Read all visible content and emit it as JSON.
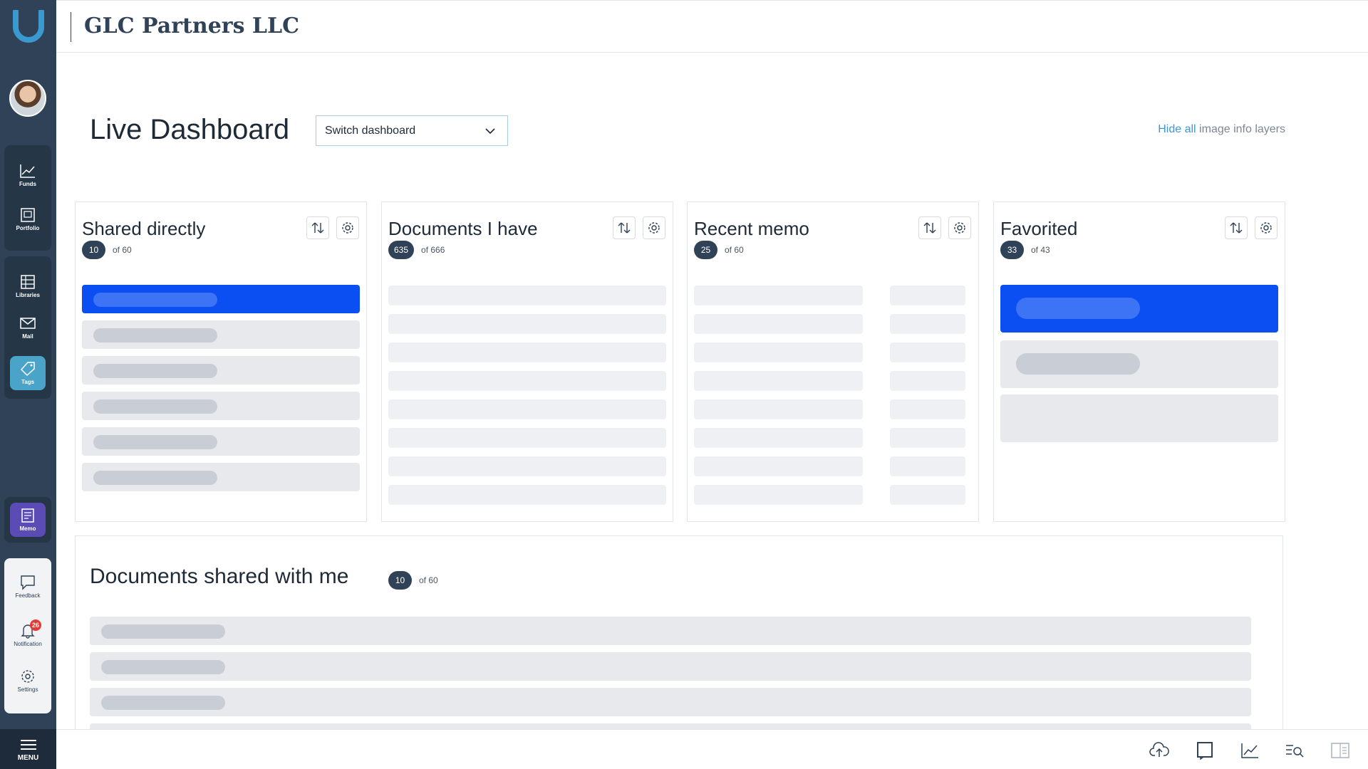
{
  "sidebar": {
    "nav": [
      {
        "id": "funds",
        "label": "Funds",
        "icon": "chart-line-icon"
      },
      {
        "id": "portfolio",
        "label": "Portfolio",
        "icon": "portfolio-icon"
      },
      {
        "id": "libraries",
        "label": "Libraries",
        "icon": "library-icon"
      },
      {
        "id": "mail",
        "label": "Mail",
        "icon": "mail-icon"
      },
      {
        "id": "tags",
        "label": "Tags",
        "icon": "tag-icon"
      },
      {
        "id": "memo",
        "label": "Memo",
        "icon": "memo-icon"
      }
    ],
    "utility": {
      "feedback_label": "Feedback",
      "notification_label": "Notification",
      "notification_count": "26",
      "settings_label": "Settings"
    },
    "menu_label": "MENU"
  },
  "header": {
    "company": "GLC Partners LLC"
  },
  "page": {
    "title": "Live Dashboard",
    "switch_dashboard": "Switch dashboard",
    "hide_all_link": "Hide all",
    "hide_all_suffix": " image info layers"
  },
  "widgets": [
    {
      "title": "Shared directly",
      "count": "10",
      "of_text": "of 60"
    },
    {
      "title": "Documents I have",
      "count": "635",
      "of_text": "of 666"
    },
    {
      "title": "Recent memo",
      "count": "25",
      "of_text": "of 60"
    },
    {
      "title": "Favorited",
      "count": "33",
      "of_text": "of 43"
    }
  ],
  "shared_with_me": {
    "title": "Documents shared with me",
    "count": "10",
    "of_text": "of 60"
  },
  "colors": {
    "sidebar": "#2f4257",
    "accent_blue": "#0b4ef2",
    "link": "#3a9ad0",
    "tags_active": "#4aa3c9",
    "memo_active": "#5b4bb5",
    "notification_badge": "#e53935"
  }
}
